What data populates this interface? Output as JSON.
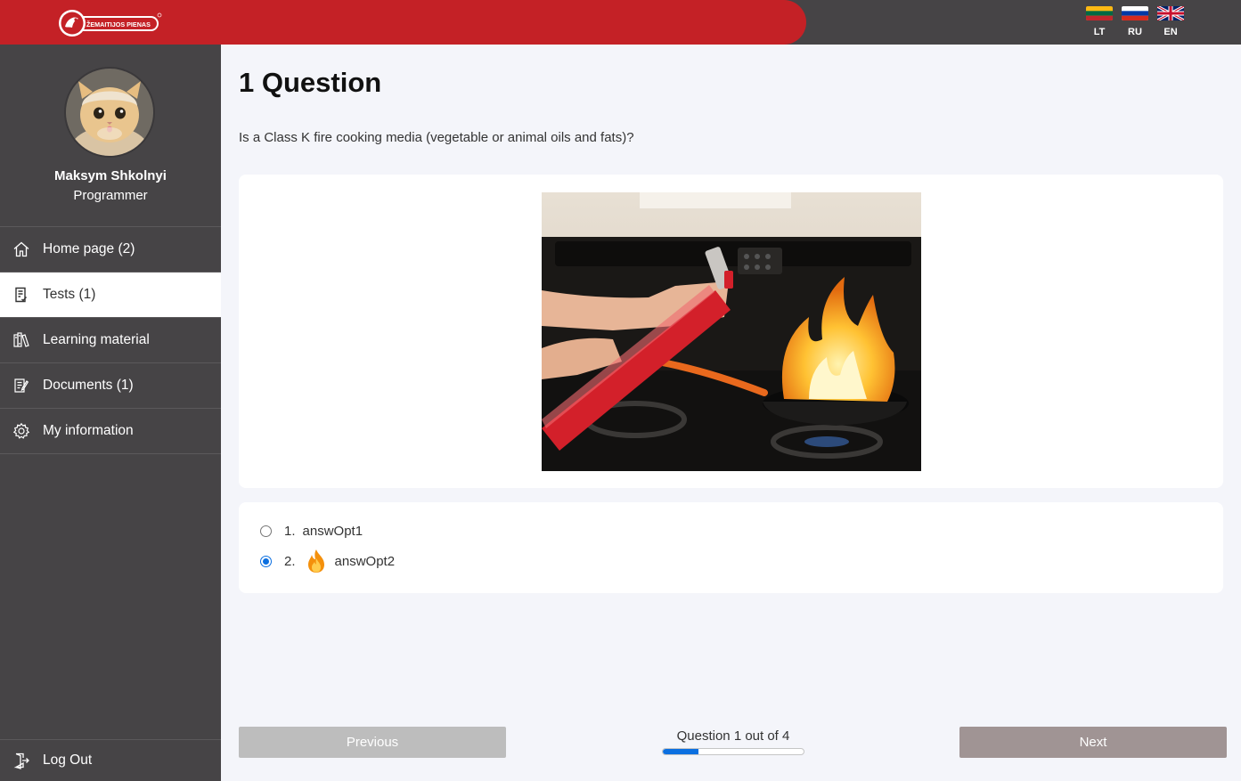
{
  "header": {
    "brand": "ŽEMAITIJOS PIENAS",
    "languages": [
      {
        "code": "LT",
        "flag": "lithuania-flag"
      },
      {
        "code": "RU",
        "flag": "russia-flag"
      },
      {
        "code": "EN",
        "flag": "uk-flag"
      }
    ]
  },
  "user": {
    "name": "Maksym Shkolnyi",
    "role": "Programmer"
  },
  "nav": {
    "items": [
      {
        "label": "Home page (2)",
        "icon": "home-icon"
      },
      {
        "label": "Tests (1)",
        "icon": "tests-icon",
        "active": true
      },
      {
        "label": "Learning material",
        "icon": "books-icon"
      },
      {
        "label": "Documents (1)",
        "icon": "documents-icon"
      },
      {
        "label": "My information",
        "icon": "gear-icon"
      }
    ],
    "logout": "Log Out"
  },
  "question": {
    "title": "1 Question",
    "text": "Is a Class K fire cooking media (vegetable or animal oils and fats)?",
    "answers": [
      {
        "number": "1.",
        "label": "answOpt1",
        "selected": false
      },
      {
        "number": "2.",
        "label": "answOpt2",
        "selected": true,
        "emoji": "fire-icon"
      }
    ]
  },
  "footer": {
    "previous": "Previous",
    "next": "Next",
    "progress_label": "Question 1 out of 4",
    "current": 1,
    "total": 4
  },
  "colors": {
    "brand_red": "#c42126",
    "sidebar": "#464446",
    "accent_blue": "#0b6fe0"
  }
}
